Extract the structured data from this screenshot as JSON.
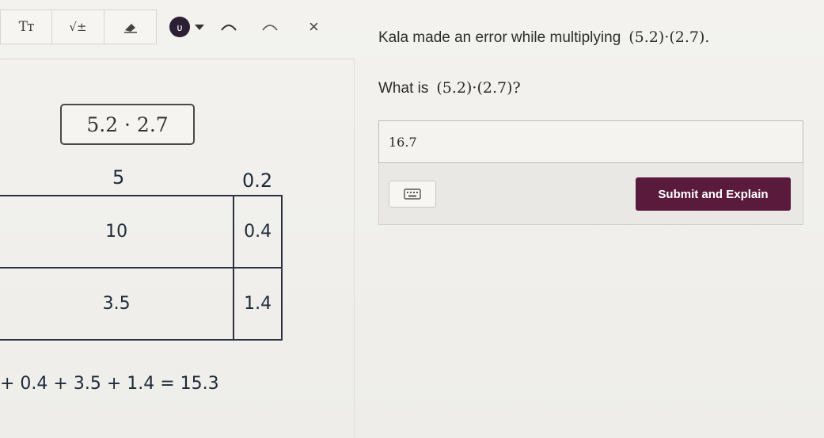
{
  "toolbar": {
    "text_tool": "Tт",
    "sqrt_tool": "√±",
    "pen_tool": "ʋ",
    "close": "×"
  },
  "prompt": {
    "text": "Kala made an error while multiplying",
    "expr": "(5.2)·(2.7)."
  },
  "question": {
    "text": "What is",
    "expr": "(5.2)·(2.7)?"
  },
  "answer": {
    "value": "16.7",
    "submit_label": "Submit and Explain"
  },
  "work": {
    "expression": "5.2 · 2.7",
    "col_labels": [
      "5",
      "0.2"
    ],
    "rows": [
      [
        "10",
        "0.4"
      ],
      [
        "3.5",
        "1.4"
      ]
    ],
    "sum": "+ 0.4 + 3.5 + 1.4 = 15.3"
  },
  "colors": {
    "submit": "#5a1a3c",
    "ink": "#1f2a3a"
  }
}
